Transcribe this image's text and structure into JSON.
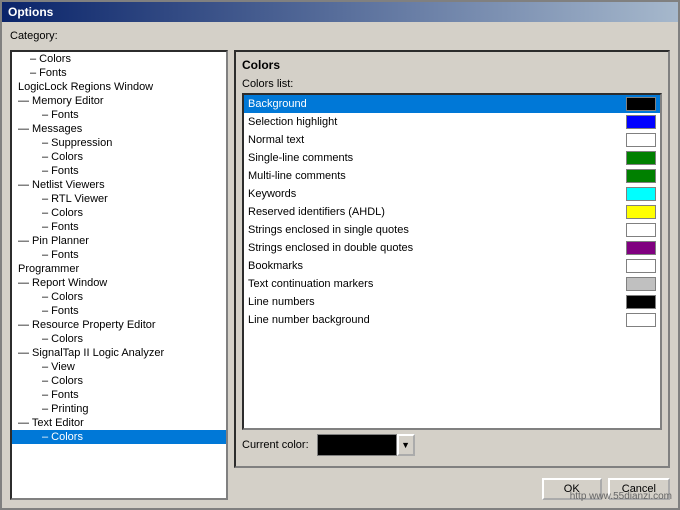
{
  "window": {
    "title": "Options"
  },
  "category_label": "Category:",
  "tree": {
    "items": [
      {
        "id": "colors",
        "label": "Colors",
        "level": "child",
        "expand": ""
      },
      {
        "id": "fonts",
        "label": "Fonts",
        "level": "child",
        "expand": ""
      },
      {
        "id": "logilock",
        "label": "LogicLock Regions Window",
        "level": "root",
        "expand": ""
      },
      {
        "id": "memory-editor",
        "label": "Memory Editor",
        "level": "root",
        "expand": "—"
      },
      {
        "id": "memory-fonts",
        "label": "Fonts",
        "level": "child2",
        "expand": ""
      },
      {
        "id": "messages",
        "label": "Messages",
        "level": "root",
        "expand": "—"
      },
      {
        "id": "suppression",
        "label": "Suppression",
        "level": "child2",
        "expand": ""
      },
      {
        "id": "msg-colors",
        "label": "Colors",
        "level": "child2",
        "expand": ""
      },
      {
        "id": "msg-fonts",
        "label": "Fonts",
        "level": "child2",
        "expand": ""
      },
      {
        "id": "netlist-viewers",
        "label": "Netlist Viewers",
        "level": "root",
        "expand": "—"
      },
      {
        "id": "rtl-viewer",
        "label": "RTL Viewer",
        "level": "child2",
        "expand": ""
      },
      {
        "id": "nv-colors",
        "label": "Colors",
        "level": "child2",
        "expand": ""
      },
      {
        "id": "nv-fonts",
        "label": "Fonts",
        "level": "child2",
        "expand": ""
      },
      {
        "id": "pin-planner",
        "label": "Pin Planner",
        "level": "root",
        "expand": "—"
      },
      {
        "id": "pp-fonts",
        "label": "Fonts",
        "level": "child2",
        "expand": ""
      },
      {
        "id": "programmer",
        "label": "Programmer",
        "level": "root",
        "expand": ""
      },
      {
        "id": "report-window",
        "label": "Report Window",
        "level": "root",
        "expand": "—"
      },
      {
        "id": "rw-colors",
        "label": "Colors",
        "level": "child2",
        "expand": ""
      },
      {
        "id": "rw-fonts",
        "label": "Fonts",
        "level": "child2",
        "expand": ""
      },
      {
        "id": "resource-property-editor",
        "label": "Resource Property Editor",
        "level": "root",
        "expand": "—"
      },
      {
        "id": "rpe-colors",
        "label": "Colors",
        "level": "child2",
        "expand": ""
      },
      {
        "id": "signaltap",
        "label": "SignalTap II Logic Analyzer",
        "level": "root",
        "expand": "—"
      },
      {
        "id": "st-view",
        "label": "View",
        "level": "child2",
        "expand": ""
      },
      {
        "id": "st-colors",
        "label": "Colors",
        "level": "child2",
        "expand": ""
      },
      {
        "id": "st-fonts",
        "label": "Fonts",
        "level": "child2",
        "expand": ""
      },
      {
        "id": "st-printing",
        "label": "Printing",
        "level": "child2",
        "expand": ""
      },
      {
        "id": "text-editor",
        "label": "Text Editor",
        "level": "root",
        "expand": "—"
      },
      {
        "id": "te-colors",
        "label": "Colors",
        "level": "child2",
        "expand": "",
        "selected": true
      }
    ]
  },
  "colors_panel": {
    "title": "Colors",
    "list_label": "Colors list:",
    "items": [
      {
        "label": "Background",
        "color": "#000000",
        "selected": true
      },
      {
        "label": "Selection highlight",
        "color": "#0000ff",
        "selected": false
      },
      {
        "label": "Normal text",
        "color": "#ffffff",
        "selected": false
      },
      {
        "label": "Single-line comments",
        "color": "#008000",
        "selected": false
      },
      {
        "label": "Multi-line comments",
        "color": "#008000",
        "selected": false
      },
      {
        "label": "Keywords",
        "color": "#00ffff",
        "selected": false
      },
      {
        "label": "Reserved identifiers (AHDL)",
        "color": "#ffff00",
        "selected": false
      },
      {
        "label": "Strings enclosed in single quotes",
        "color": "#ffffff",
        "selected": false
      },
      {
        "label": "Strings enclosed in double quotes",
        "color": "#800080",
        "selected": false
      },
      {
        "label": "Bookmarks",
        "color": "#ffffff",
        "selected": false
      },
      {
        "label": "Text continuation markers",
        "color": "#c0c0c0",
        "selected": false
      },
      {
        "label": "Line numbers",
        "color": "#000000",
        "selected": false
      },
      {
        "label": "Line number background",
        "color": "#ffffff",
        "selected": false
      }
    ]
  },
  "current_color": {
    "label": "Current color:",
    "value": "#000000"
  },
  "buttons": {
    "ok": "OK",
    "cancel": "Cancel"
  },
  "watermark": "http www.55dianzi.com"
}
